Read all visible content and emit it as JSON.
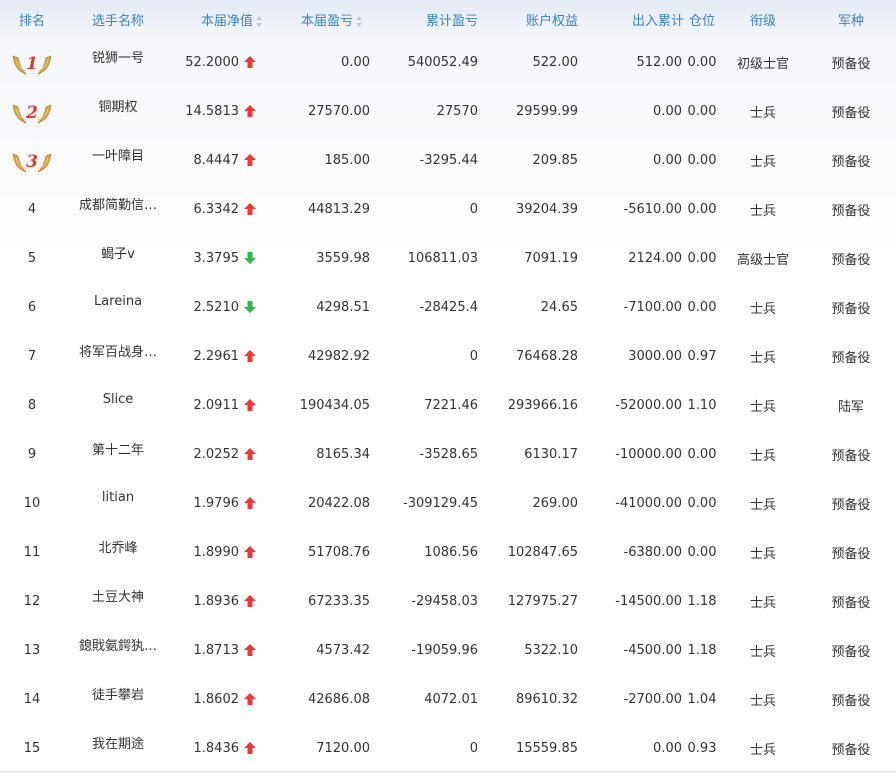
{
  "headers": {
    "rank": "排名",
    "player": "选手名称",
    "nav": "本届净值",
    "profit": "本届盈亏",
    "total_profit": "累计盈亏",
    "equity": "账户权益",
    "inout": "出入累计",
    "position": "仓位",
    "title": "衔级",
    "army": "军种"
  },
  "colors": {
    "header": "#3a84c8",
    "up": "#e8393a",
    "down": "#2db84a",
    "medal_gold": "#d9a441",
    "medal_red": "#e23a2f"
  },
  "rows": [
    {
      "rank": "1",
      "name": "锐狮一号",
      "nav": "52.2000",
      "trend": "up",
      "profit": "0.00",
      "total": "540052.49",
      "equity": "522.00",
      "inout": "512.00",
      "pos": "0.00",
      "title": "初级士官",
      "army": "预备役"
    },
    {
      "rank": "2",
      "name": "铜期权",
      "nav": "14.5813",
      "trend": "up",
      "profit": "27570.00",
      "total": "27570",
      "equity": "29599.99",
      "inout": "0.00",
      "pos": "0.00",
      "title": "士兵",
      "army": "预备役"
    },
    {
      "rank": "3",
      "name": "一叶障目",
      "nav": "8.4447",
      "trend": "up",
      "profit": "185.00",
      "total": "-3295.44",
      "equity": "209.85",
      "inout": "0.00",
      "pos": "0.00",
      "title": "士兵",
      "army": "预备役"
    },
    {
      "rank": "4",
      "name": "成都简勤信…",
      "nav": "6.3342",
      "trend": "up",
      "profit": "44813.29",
      "total": "0",
      "equity": "39204.39",
      "inout": "-5610.00",
      "pos": "0.00",
      "title": "士兵",
      "army": "预备役"
    },
    {
      "rank": "5",
      "name": "蝎子v",
      "nav": "3.3795",
      "trend": "down",
      "profit": "3559.98",
      "total": "106811.03",
      "equity": "7091.19",
      "inout": "2124.00",
      "pos": "0.00",
      "title": "高级士官",
      "army": "预备役"
    },
    {
      "rank": "6",
      "name": "Lareina",
      "nav": "2.5210",
      "trend": "down",
      "profit": "4298.51",
      "total": "-28425.4",
      "equity": "24.65",
      "inout": "-7100.00",
      "pos": "0.00",
      "title": "士兵",
      "army": "预备役"
    },
    {
      "rank": "7",
      "name": "将军百战身…",
      "nav": "2.2961",
      "trend": "up",
      "profit": "42982.92",
      "total": "0",
      "equity": "76468.28",
      "inout": "3000.00",
      "pos": "0.97",
      "title": "士兵",
      "army": "预备役"
    },
    {
      "rank": "8",
      "name": "Slice",
      "nav": "2.0911",
      "trend": "up",
      "profit": "190434.05",
      "total": "7221.46",
      "equity": "293966.16",
      "inout": "-52000.00",
      "pos": "1.10",
      "title": "士兵",
      "army": "陆军"
    },
    {
      "rank": "9",
      "name": "第十二年",
      "nav": "2.0252",
      "trend": "up",
      "profit": "8165.34",
      "total": "-3528.65",
      "equity": "6130.17",
      "inout": "-10000.00",
      "pos": "0.00",
      "title": "士兵",
      "army": "预备役"
    },
    {
      "rank": "10",
      "name": "litian",
      "nav": "1.9796",
      "trend": "up",
      "profit": "20422.08",
      "total": "-309129.45",
      "equity": "269.00",
      "inout": "-41000.00",
      "pos": "0.00",
      "title": "士兵",
      "army": "预备役"
    },
    {
      "rank": "11",
      "name": "北乔峰",
      "nav": "1.8990",
      "trend": "up",
      "profit": "51708.76",
      "total": "1086.56",
      "equity": "102847.65",
      "inout": "-6380.00",
      "pos": "0.00",
      "title": "士兵",
      "army": "预备役"
    },
    {
      "rank": "12",
      "name": "土豆大神",
      "nav": "1.8936",
      "trend": "up",
      "profit": "67233.35",
      "total": "-29458.03",
      "equity": "127975.27",
      "inout": "-14500.00",
      "pos": "1.18",
      "title": "士兵",
      "army": "预备役"
    },
    {
      "rank": "13",
      "name": "鎴戝氨鍔犱…",
      "nav": "1.8713",
      "trend": "up",
      "profit": "4573.42",
      "total": "-19059.96",
      "equity": "5322.10",
      "inout": "-4500.00",
      "pos": "1.18",
      "title": "士兵",
      "army": "预备役"
    },
    {
      "rank": "14",
      "name": "徒手攀岩",
      "nav": "1.8602",
      "trend": "up",
      "profit": "42686.08",
      "total": "4072.01",
      "equity": "89610.32",
      "inout": "-2700.00",
      "pos": "1.04",
      "title": "士兵",
      "army": "预备役"
    },
    {
      "rank": "15",
      "name": "我在期途",
      "nav": "1.8436",
      "trend": "up",
      "profit": "7120.00",
      "total": "0",
      "equity": "15559.85",
      "inout": "0.00",
      "pos": "0.93",
      "title": "士兵",
      "army": "预备役"
    }
  ]
}
